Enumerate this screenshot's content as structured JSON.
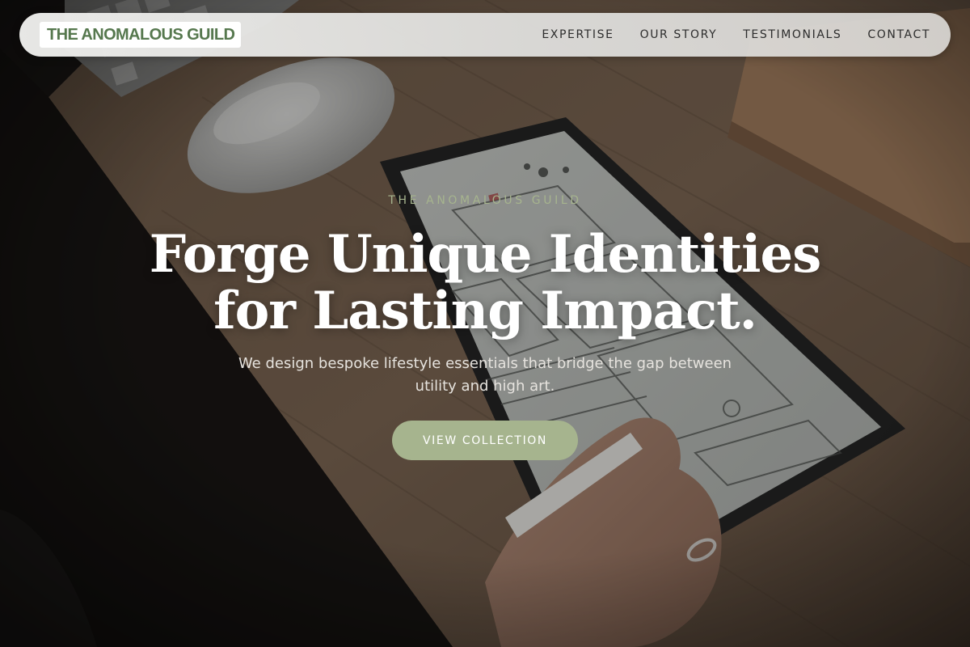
{
  "nav": {
    "logo_text": "THE ANOMALOUS GUILD",
    "links": [
      {
        "label": "EXPERTISE"
      },
      {
        "label": "OUR STORY"
      },
      {
        "label": "TESTIMONIALS"
      },
      {
        "label": "CONTACT"
      }
    ]
  },
  "hero": {
    "eyebrow": "THE ANOMALOUS GUILD",
    "headline_line1": "Forge Unique Identities",
    "headline_line2": "for Lasting Impact.",
    "subtitle": "We design bespoke lifestyle essentials that bridge the gap between utility and high art.",
    "cta_label": "VIEW COLLECTION"
  },
  "colors": {
    "accent_sage": "#a6b48e",
    "logo_green": "#56784e",
    "headline": "#ffffff"
  }
}
